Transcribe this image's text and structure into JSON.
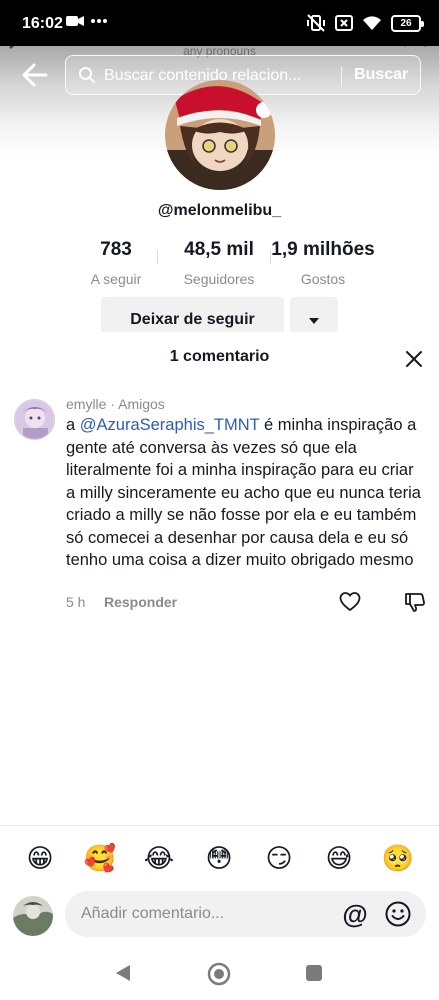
{
  "status_bar": {
    "time": "16:02",
    "battery": "26",
    "icons": [
      "video-camera-icon",
      "more-dots-icon",
      "vibrate-off-icon",
      "sim-x-icon",
      "wifi-icon",
      "battery-icon"
    ]
  },
  "profile": {
    "pronouns": "any pronouns",
    "search_placeholder": "Buscar contenido relacion...",
    "search_button": "Buscar",
    "username": "@melonmelibu_",
    "stats": [
      {
        "value": "783",
        "label": "A seguir"
      },
      {
        "value": "48,5 mil",
        "label": "Seguidores"
      },
      {
        "value": "1,9 milhões",
        "label": "Gostos"
      }
    ],
    "unfollow_label": "Deixar de seguir"
  },
  "comments_sheet": {
    "title": "1 comentario",
    "comment": {
      "author_meta": "emylle · Amigos",
      "prefix": "a ",
      "mention": "@AzuraSeraphis_TMNT",
      "text": " é minha inspiração a gente até conversa às vezes só que ela literalmente foi a minha inspiração para eu criar a milly sinceramente eu acho que eu nunca teria criado a milly se não fosse por ela e eu também só comecei a desenhar por causa dela e eu só tenho uma coisa a dizer muito obrigado mesmo",
      "time": "5 h",
      "reply_label": "Responder"
    },
    "emojis": [
      "😁",
      "🥰",
      "😂",
      "😳",
      "😏",
      "😅",
      "🥺"
    ],
    "input_placeholder": "Añadir comentario...",
    "at_symbol": "@"
  },
  "colors": {
    "mention": "#2b5db9",
    "secondary_text": "#8a8b91",
    "button_bg": "#f1f1f2"
  }
}
